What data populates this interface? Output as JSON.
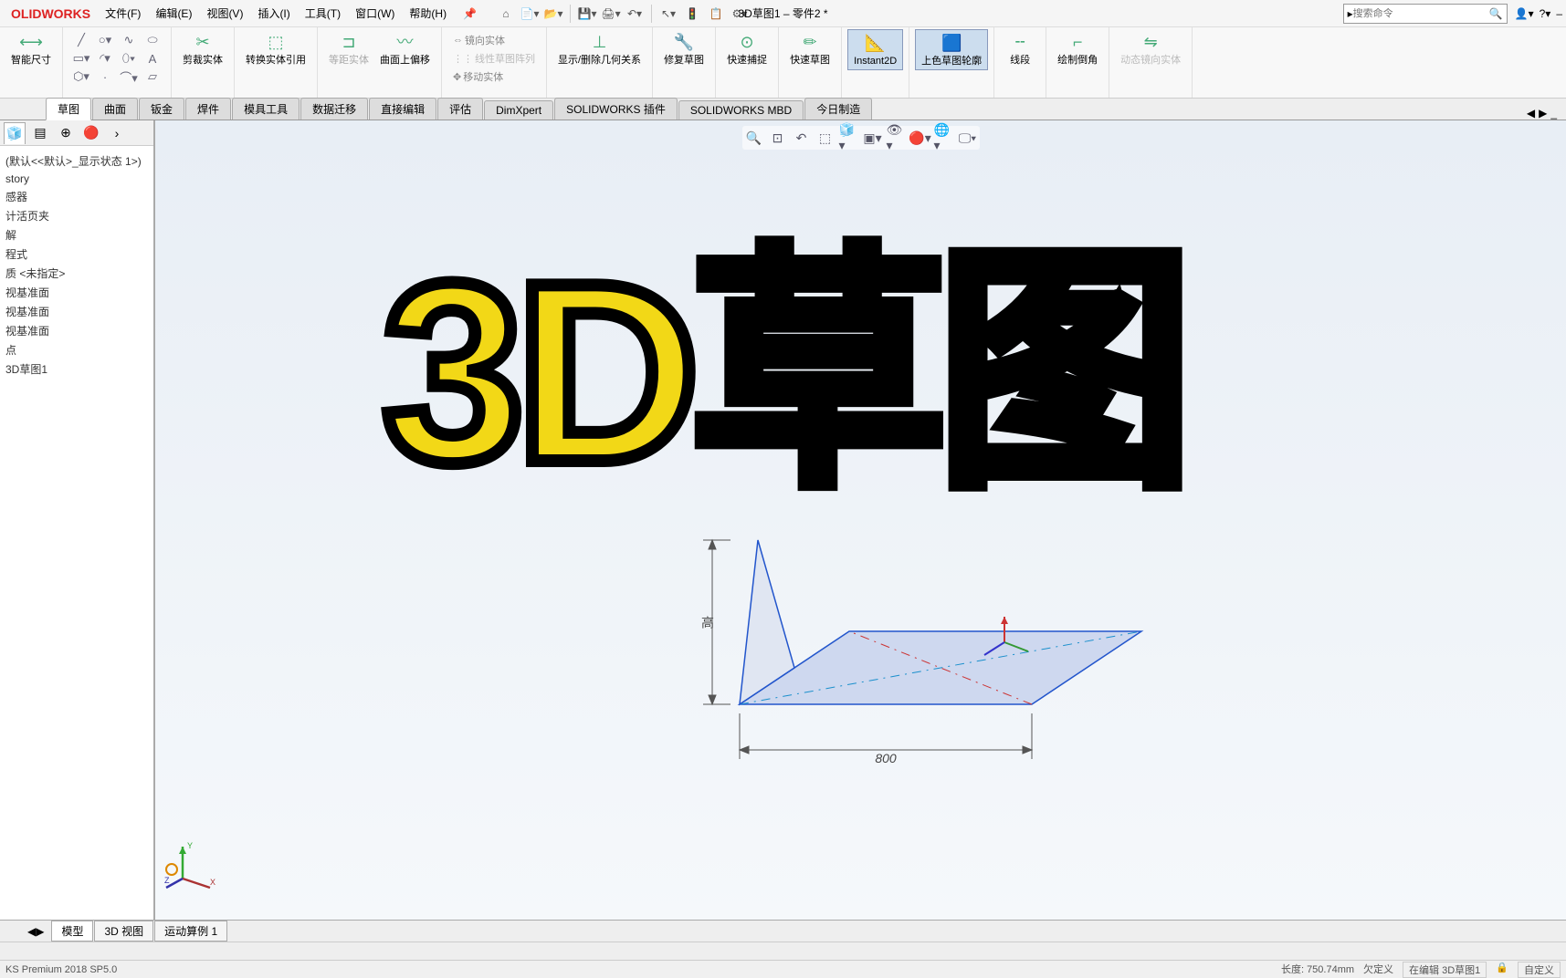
{
  "app": {
    "logo": "OLIDWORKS",
    "doc_title": "3D草图1 – 零件2 *",
    "search_placeholder": "搜索命令"
  },
  "menubar": {
    "items": [
      "文件(F)",
      "编辑(E)",
      "视图(V)",
      "插入(I)",
      "工具(T)",
      "窗口(W)",
      "帮助(H)"
    ]
  },
  "ribbon": {
    "smart_dim": "智能尺寸",
    "trim": "剪裁实体",
    "convert": "转换实体引用",
    "offset_eq": "等距实体",
    "offset_curve": "曲面上偏移",
    "mirror": "镜向实体",
    "linear_pattern": "线性草图阵列",
    "move": "移动实体",
    "show_del": "显示/删除几何关系",
    "repair": "修复草图",
    "quick_snap": "快速捕捉",
    "quick_sketch": "快速草图",
    "instant2d": "Instant2D",
    "color_sketch": "上色草图轮廓",
    "line_seg": "线段",
    "fillet2": "绘制倒角",
    "dyn_mirror": "动态镜向实体"
  },
  "tabs": {
    "items": [
      "草图",
      "曲面",
      "钣金",
      "焊件",
      "模具工具",
      "数据迁移",
      "直接编辑",
      "评估",
      "DimXpert",
      "SOLIDWORKS 插件",
      "SOLIDWORKS MBD",
      "今日制造"
    ]
  },
  "tree": {
    "header": "(默认<<默认>_显示状态 1>)",
    "items": [
      "story",
      "感器",
      "计活页夹",
      "解",
      "程式",
      "质 <未指定>",
      "视基准面",
      "视基准面",
      "视基准面",
      "点",
      "3D草图1"
    ]
  },
  "sketch": {
    "dim_a": "高",
    "dim_b": "800"
  },
  "bottom_tabs": {
    "items": [
      "模型",
      "3D 视图",
      "运动算例 1"
    ]
  },
  "status": {
    "version": "KS Premium 2018 SP5.0",
    "length": "长度: 750.74mm",
    "under": "欠定义",
    "editing": "在编辑 3D草图1",
    "custom": "自定义"
  },
  "overlay": "3D草图"
}
